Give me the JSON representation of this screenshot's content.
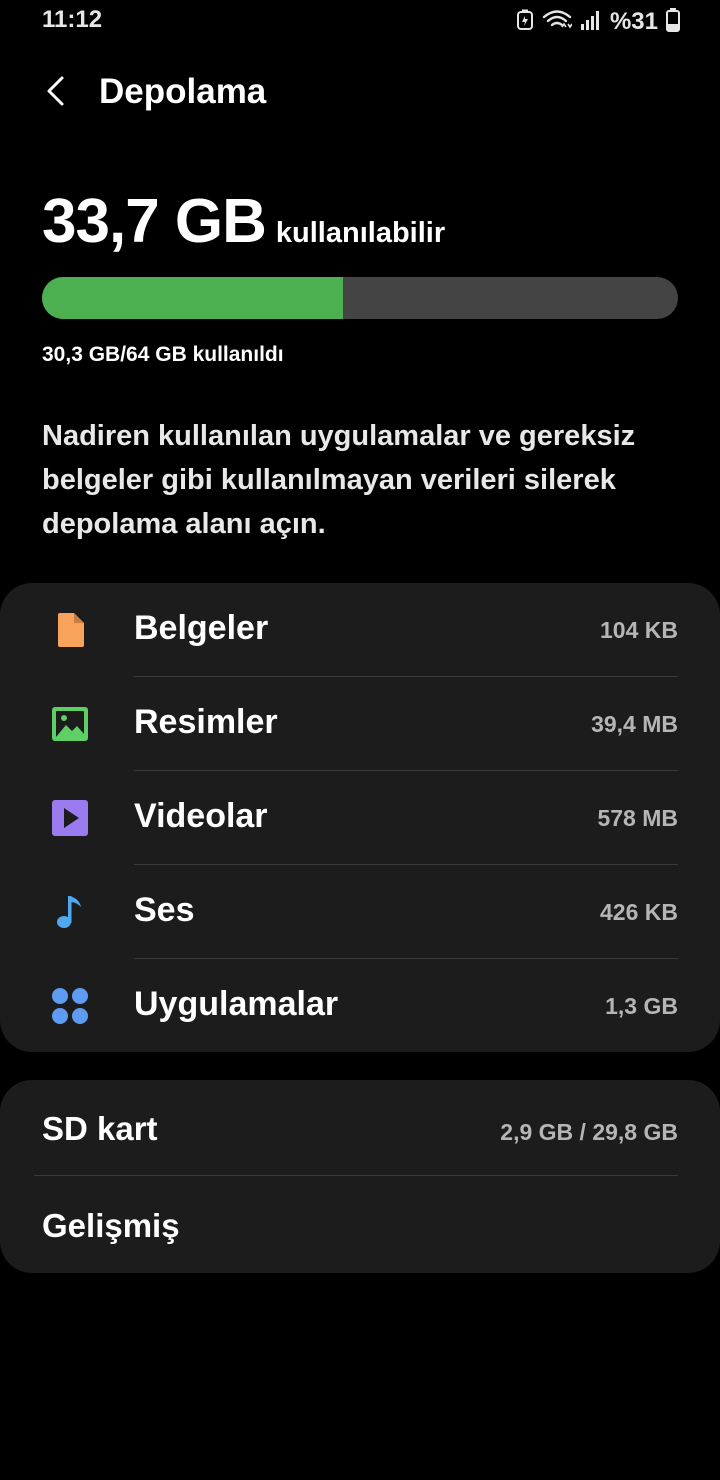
{
  "status_bar": {
    "time": "11:12",
    "battery_text": "%31"
  },
  "header": {
    "title": "Depolama"
  },
  "storage": {
    "available_value": "33,7 GB",
    "available_label": "kullanılabilir",
    "used_text": "30,3 GB/64 GB kullanıldı",
    "used_fraction": 0.473,
    "description": "Nadiren kullanılan uygulamalar ve gereksiz belgeler gibi kullanılmayan verileri silerek depolama alanı açın."
  },
  "categories": [
    {
      "label": "Belgeler",
      "size": "104 KB",
      "icon": "document-icon",
      "color": "#f7a35c"
    },
    {
      "label": "Resimler",
      "size": "39,4 MB",
      "icon": "image-icon",
      "color": "#5fcf65"
    },
    {
      "label": "Videolar",
      "size": "578 MB",
      "icon": "video-icon",
      "color": "#9b7cf0"
    },
    {
      "label": "Ses",
      "size": "426 KB",
      "icon": "music-icon",
      "color": "#4fa8f0"
    },
    {
      "label": "Uygulamalar",
      "size": "1,3 GB",
      "icon": "apps-icon",
      "color": "#5d9cf2"
    }
  ],
  "extra": {
    "sd_label": "SD kart",
    "sd_size": "2,9 GB / 29,8 GB",
    "advanced_label": "Gelişmiş"
  },
  "colors": {
    "progress_fill": "#4caf50",
    "progress_track": "#444444",
    "card_background": "#1c1c1c"
  }
}
